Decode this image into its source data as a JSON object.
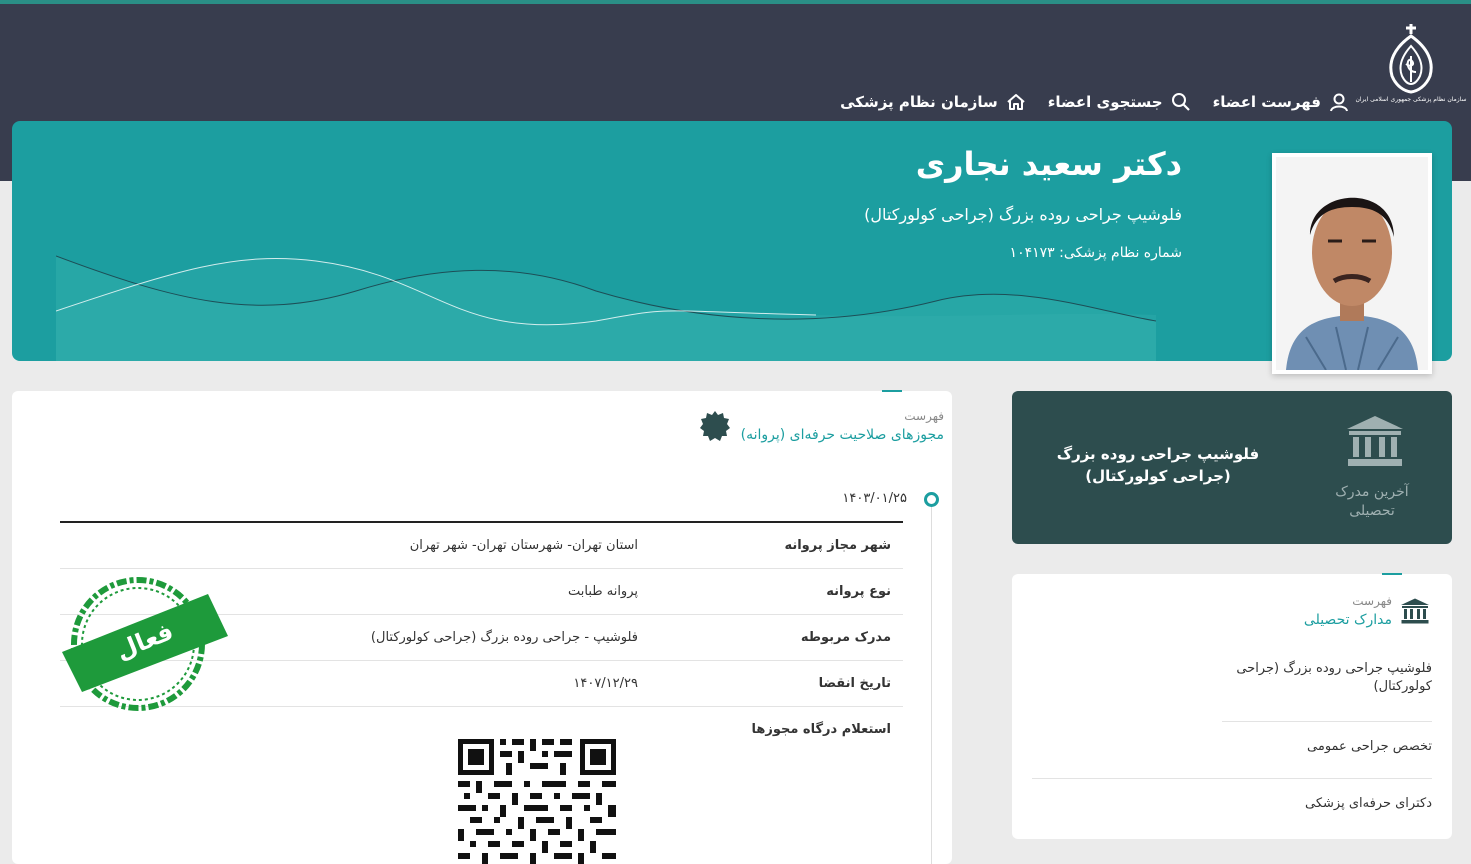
{
  "header": {
    "logo_caption": "سازمان نظام پزشکی جمهوری اسلامی ایران",
    "logo_icon": "medical-council-emblem-icon",
    "nav": [
      {
        "label": "سازمان نظام پزشکی",
        "icon": "home-icon"
      },
      {
        "label": "جستجوی اعضاء",
        "icon": "search-icon"
      },
      {
        "label": "فهرست اعضاء",
        "icon": "user-icon"
      }
    ]
  },
  "profile": {
    "name": "دکتر سعید نجاری",
    "specialty": "فلوشیپ جراحی روده بزرگ (جراحی کولورکتال)",
    "code_text": "شماره نظام پزشکی: ۱۰۴۱۷۳"
  },
  "licenses": {
    "head_small": "فهرست",
    "head_title": "مجوزهای صلاحیت حرفه‌ای (پروانه)",
    "date": "۱۴۰۳/۰۱/۲۵",
    "rows": [
      {
        "label": "شهر مجاز پروانه",
        "value": "استان تهران- شهرستان تهران- شهر تهران"
      },
      {
        "label": "نوع پروانه",
        "value": "پروانه طبابت"
      },
      {
        "label": "مدرک مربوطه",
        "value": "فلوشیپ - جراحی روده بزرگ (جراحی کولورکتال)"
      },
      {
        "label": "تاریخ انقضا",
        "value": "۱۴۰۷/۱۲/۲۹"
      },
      {
        "label": "استعلام درگاه مجوزها",
        "value": ""
      }
    ],
    "stamp_text": "فعال",
    "stamp_color": "#1e9a3b",
    "accent": "#1c9ea0"
  },
  "latest_degree": {
    "caption": "آخرین مدرک تحصیلی",
    "title": "فلوشیپ جراحی روده بزرگ (جراحی کولورکتال)",
    "icon": "institution-icon"
  },
  "education": {
    "head_small": "فهرست",
    "head_title": "مدارک تحصیلی",
    "items": [
      "فلوشیپ جراحی روده بزرگ (جراحی کولورکتال)",
      "تخصص جراحی عمومی",
      "دکترای حرفه‌ای پزشکی"
    ]
  }
}
